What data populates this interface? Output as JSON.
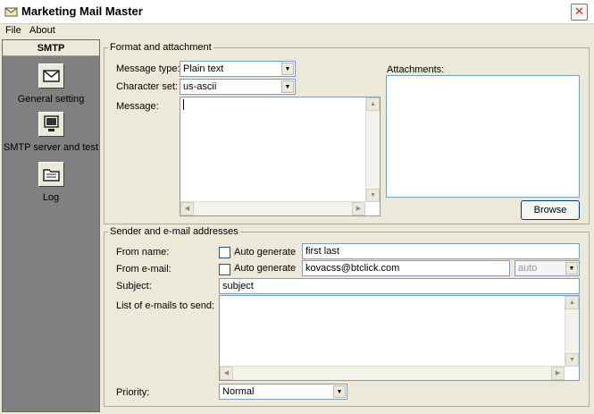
{
  "window": {
    "title": "Marketing Mail Master",
    "close_glyph": "✕"
  },
  "menu": {
    "file_label": "File",
    "about_label": "About"
  },
  "sidebar": {
    "header": "SMTP",
    "items": [
      {
        "label": "General setting",
        "icon": "envelope-icon"
      },
      {
        "label": "SMTP server and test",
        "icon": "server-monitor-icon"
      },
      {
        "label": "Log",
        "icon": "log-folder-icon"
      }
    ]
  },
  "format_group": {
    "title": "Format and attachment",
    "message_type_label": "Message type:",
    "message_type_value": "Plain text",
    "charset_label": "Character set:",
    "charset_value": "us-ascii",
    "message_label": "Message:",
    "attachments_label": "Attachments:",
    "browse_label": "Browse"
  },
  "sender_group": {
    "title": "Sender and e-mail addresses",
    "from_name_label": "From name:",
    "auto_generate_label": "Auto generate",
    "from_name_value": "first last",
    "from_email_label": "From e-mail:",
    "from_email_value": "kovacss@btclick.com",
    "email_mode_value": "auto",
    "subject_label": "Subject:",
    "subject_value": "subject",
    "list_label": "List of e-mails to send:",
    "priority_label": "Priority:",
    "priority_value": "Normal"
  }
}
